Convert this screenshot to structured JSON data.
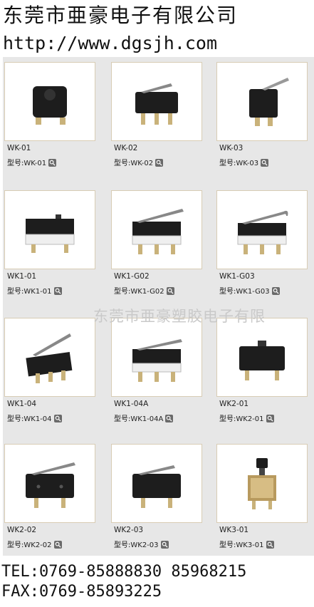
{
  "header": {
    "company": "东莞市亜豪电子有限公司",
    "url": "http://www.dgsjh.com"
  },
  "model_prefix": "型号:",
  "products": [
    {
      "name": "WK-01",
      "model": "WK-01",
      "icon": "micro-switch-square-icon"
    },
    {
      "name": "WK-02",
      "model": "WK-02",
      "icon": "micro-switch-short-lever-icon"
    },
    {
      "name": "WK-03",
      "model": "WK-03",
      "icon": "micro-switch-side-lever-icon"
    },
    {
      "name": "WK1-01",
      "model": "WK1-01",
      "icon": "micro-switch-plunger-icon"
    },
    {
      "name": "WK1-G02",
      "model": "WK1-G02",
      "icon": "micro-switch-long-lever-icon"
    },
    {
      "name": "WK1-G03",
      "model": "WK1-G03",
      "icon": "micro-switch-hook-lever-icon"
    },
    {
      "name": "WK1-04",
      "model": "WK1-04",
      "icon": "micro-switch-angled-lever-icon"
    },
    {
      "name": "WK1-04A",
      "model": "WK1-04A",
      "icon": "micro-switch-lever-icon"
    },
    {
      "name": "WK2-01",
      "model": "WK2-01",
      "icon": "micro-switch-black-plunger-icon"
    },
    {
      "name": "WK2-02",
      "model": "WK2-02",
      "icon": "micro-switch-black-lever-icon"
    },
    {
      "name": "WK2-03",
      "model": "WK2-03",
      "icon": "micro-switch-black-short-lever-icon"
    },
    {
      "name": "WK3-01",
      "model": "WK3-01",
      "icon": "push-button-switch-icon"
    }
  ],
  "watermark": "东莞市亜豪塑胶电子有限",
  "contact": {
    "tel": "TEL:0769-85888830   85968215",
    "fax": "FAX:0769-85893225"
  }
}
